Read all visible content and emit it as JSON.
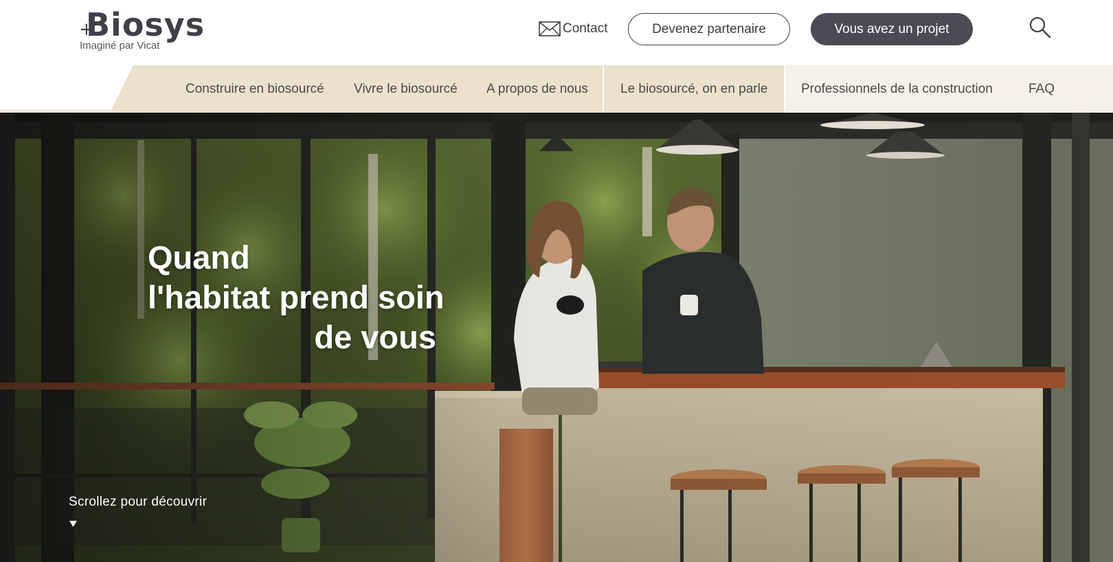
{
  "brand": {
    "logo_text": "Biosys",
    "logo_plus": "+",
    "tagline": "Imaginé par Vicat"
  },
  "header": {
    "contact_label": "Contact",
    "partner_button": "Devenez partenaire",
    "project_button": "Vous avez un projet",
    "icons": {
      "contact": "envelope-icon",
      "search": "search-icon"
    }
  },
  "nav": {
    "items": [
      {
        "label": "Construire en biosourcé"
      },
      {
        "label": "Vivre le biosourcé"
      },
      {
        "label": "A propos de nous"
      },
      {
        "label": "Le biosourcé, on en parle"
      },
      {
        "label": "Professionnels de la construction"
      },
      {
        "label": "FAQ"
      }
    ]
  },
  "hero": {
    "title_line1": "Quand",
    "title_line2": "l'habitat prend soin",
    "title_line3": "de vous",
    "scroll_hint": "Scrollez pour découvrir",
    "image_alt": "Couple discutant dans une cuisine ouverte en béton, entourée de végétation tropicale"
  },
  "colors": {
    "nav_beige": "#ece1cc",
    "nav_light": "#f5f1e9",
    "button_dark": "#4a4b53",
    "text_dark": "#3d3d3d"
  }
}
